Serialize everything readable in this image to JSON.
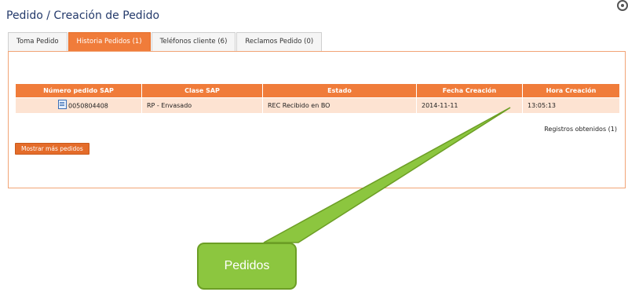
{
  "header": {
    "title": "Pedido / Creación de Pedido"
  },
  "tabs": [
    {
      "label": "Toma Pedido"
    },
    {
      "label": "Historia Pedidos (1)",
      "active": true
    },
    {
      "label": "Teléfonos cliente (6)"
    },
    {
      "label": "Reclamos Pedido (0)"
    }
  ],
  "table": {
    "columns": [
      "Número pedido SAP",
      "Clase SAP",
      "Estado",
      "Fecha Creación",
      "Hora Creación"
    ],
    "rows": [
      [
        "0050804408",
        "RP - Envasado",
        "REC Recibido en BO",
        "2014-11-11",
        "13:05:13"
      ]
    ]
  },
  "records_text": "Registros obtenidos (1)",
  "more_button_label": "Mostrar más pedidos",
  "callout": {
    "label": "Pedidos"
  },
  "colors": {
    "accent": "#f07c3a",
    "row_bg": "#fde3d2",
    "title": "#243a6b",
    "callout": "#8cc63f"
  },
  "icons": [
    "settings-icon",
    "edit-order-icon"
  ]
}
